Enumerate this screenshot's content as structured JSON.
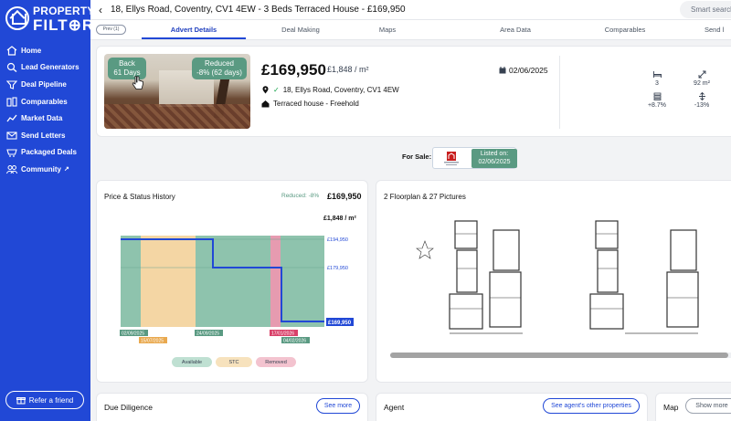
{
  "brand": {
    "line1": "PROPERTY",
    "line2": "FILT⊕R"
  },
  "sidebar": {
    "items": [
      {
        "label": "Home",
        "icon": "home-icon"
      },
      {
        "label": "Lead Generators",
        "icon": "magnifier-home-icon"
      },
      {
        "label": "Deal Pipeline",
        "icon": "pipeline-icon"
      },
      {
        "label": "Comparables",
        "icon": "compare-icon"
      },
      {
        "label": "Market Data",
        "icon": "chart-line-icon"
      },
      {
        "label": "Send Letters",
        "icon": "envelope-icon"
      },
      {
        "label": "Packaged Deals",
        "icon": "basket-icon"
      },
      {
        "label": "Community",
        "icon": "people-icon"
      }
    ],
    "refer_label": "Refer a friend"
  },
  "header": {
    "title": "18, Ellys Road, Coventry, CV1 4EW - 3 Beds Terraced House - £169,950",
    "search_placeholder": "Smart search"
  },
  "tabs": {
    "prev_label": "Prev (1)",
    "items": [
      "Advert Details",
      "Deal Making",
      "Maps",
      "Area Data",
      "Comparables",
      "Send l"
    ],
    "active": "Advert Details"
  },
  "property": {
    "badge_back": "Back",
    "badge_back_days": "61 Days",
    "badge_reduced": "Reduced",
    "badge_reduced_detail": "-8% (62 days)",
    "price": "£169,950",
    "price_per_sqm": "£1,848 / m²",
    "date": "02/06/2025",
    "address": "18, Ellys Road, Coventry, CV1 4EW",
    "type": "Terraced house",
    "tenure": "Freehold",
    "stats": [
      {
        "icon": "bed-icon",
        "value": "3"
      },
      {
        "icon": "expand-icon",
        "value": "92 m²"
      },
      {
        "icon": "money-stack-icon",
        "value": "+8.7%"
      },
      {
        "icon": "arrows-vertical-icon",
        "value": "-13%"
      }
    ]
  },
  "for_sale": {
    "label": "For Sale:",
    "listed_on_label": "Listed on:",
    "listed_on_date": "02/06/2025"
  },
  "price_history": {
    "title": "Price & Status History",
    "reduced_note": "Reduced: -8%",
    "price": "£169,950",
    "per_sqm": "£1,848 / m²",
    "legend": [
      "Available",
      "STC",
      "Removed"
    ]
  },
  "chart_data": {
    "type": "area",
    "ylim": [
      165000,
      198000
    ],
    "y_ticks": [
      "£194,950",
      "£179,950",
      "£169,950"
    ],
    "y_tick_values": [
      194950,
      179950,
      169950
    ],
    "price_series": [
      {
        "x": "02/09/2024",
        "y": 194950
      },
      {
        "x": "24/09/2024",
        "y": 194950
      },
      {
        "x": "24/09/2024",
        "y": 179950
      },
      {
        "x": "17/01/2025",
        "y": 179950
      },
      {
        "x": "17/01/2025",
        "y": 169950
      },
      {
        "x": "04/02/2025",
        "y": 169950
      }
    ],
    "status_bands": [
      {
        "status": "Available",
        "from": "02/09/2024",
        "to": "15/07/2024"
      },
      {
        "status": "STC",
        "from": "15/07/2024",
        "to": "24/09/2024"
      },
      {
        "status": "Available",
        "from": "24/09/2024",
        "to": "17/01/2025"
      },
      {
        "status": "Removed",
        "from": "17/01/2025",
        "to": "04/02/2025"
      },
      {
        "status": "Available",
        "from": "04/02/2025",
        "to": "end"
      }
    ],
    "x_labels": [
      "02/09/2025",
      "15/07/2025",
      "24/09/2025",
      "17/01/2026",
      "04/02/2026"
    ],
    "colors": {
      "available": "#8ec3ad",
      "stc": "#f4d6a4",
      "removed": "#e69bb0",
      "line": "#2148d6"
    }
  },
  "floorplan": {
    "title": "2 Floorplan & 27 Pictures"
  },
  "due_diligence": {
    "title": "Due Diligence",
    "button": "See more"
  },
  "agent": {
    "title": "Agent",
    "button": "See agent's other properties"
  },
  "map": {
    "title": "Map",
    "button": "Show more"
  }
}
